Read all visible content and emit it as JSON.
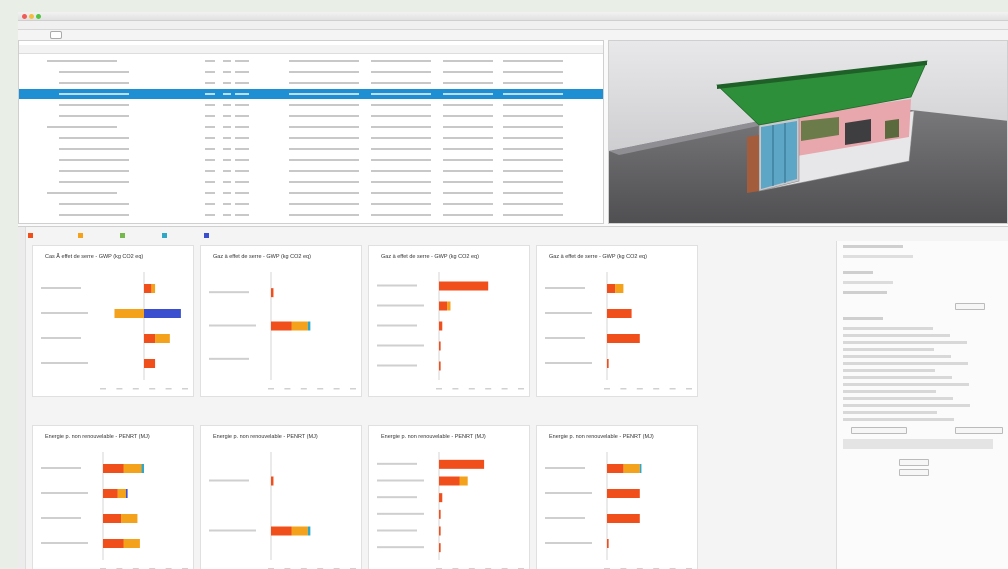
{
  "app": {
    "window_title": "",
    "menu": [
      "",
      "",
      "",
      ""
    ]
  },
  "tree": {
    "columns": [
      "",
      "",
      "",
      "",
      "",
      "",
      "",
      ""
    ],
    "row_count": 15,
    "selected_row": 3
  },
  "analysis": {
    "legend": [
      {
        "label": "",
        "color": "#f04f1c"
      },
      {
        "label": "",
        "color": "#f4a11c"
      },
      {
        "label": "",
        "color": "#76b84c"
      },
      {
        "label": "",
        "color": "#2fa8c8"
      },
      {
        "label": "",
        "color": "#3a4fd0"
      }
    ],
    "panels": [
      {
        "title": "Cas Ã effet de serre - GWP (kg CO2 eq)"
      },
      {
        "title": "Gaz à effet de serre - GWP (kg CO2 eq)"
      },
      {
        "title": "Gaz à effet de serre - GWP (kg CO2 eq)"
      },
      {
        "title": "Gaz à effet de serre - GWP (kg CO2 eq)"
      },
      {
        "title": "Energie p. non renouvelable - PENRT (MJ)"
      },
      {
        "title": "Energie p. non renouvelable - PENRT (MJ)"
      },
      {
        "title": "Energie p. non renouvelable - PENRT (MJ)"
      },
      {
        "title": "Energie p. non renouvelable - PENRT (MJ)"
      }
    ]
  },
  "chart_data": [
    {
      "type": "bar",
      "title": "Cas Ã effet de serre - GWP (kg CO2 eq)",
      "categories": [
        "",
        "",
        "",
        ""
      ],
      "series": [
        {
          "color": "#f04f1c",
          "values": [
            0.2,
            0,
            0.3,
            0.3
          ]
        },
        {
          "color": "#f4a11c",
          "values": [
            0.1,
            -0.8,
            0.4,
            0
          ]
        },
        {
          "color": "#3a4fd0",
          "values": [
            0,
            1.0,
            0,
            0
          ]
        }
      ],
      "diverging": true
    },
    {
      "type": "bar",
      "title": "Gaz à effet de serre - GWP (kg CO2 eq)",
      "categories": [
        "",
        "",
        ""
      ],
      "series": [
        {
          "color": "#f04f1c",
          "values": [
            0.03,
            0.25,
            0
          ]
        },
        {
          "color": "#f4a11c",
          "values": [
            0,
            0.2,
            0
          ]
        },
        {
          "color": "#2fa8c8",
          "values": [
            0,
            0.03,
            0
          ]
        }
      ]
    },
    {
      "type": "bar",
      "title": "Gaz à effet de serre - GWP (kg CO2 eq)",
      "categories": [
        "",
        "",
        "",
        "",
        ""
      ],
      "series": [
        {
          "color": "#f04f1c",
          "values": [
            0.6,
            0.1,
            0.04,
            0.02,
            0.02
          ]
        },
        {
          "color": "#f4a11c",
          "values": [
            0,
            0.04,
            0,
            0,
            0
          ]
        }
      ]
    },
    {
      "type": "bar",
      "title": "Gaz à effet de serre - GWP (kg CO2 eq)",
      "categories": [
        "",
        "",
        "",
        ""
      ],
      "series": [
        {
          "color": "#f04f1c",
          "values": [
            0.1,
            0.3,
            0.4,
            0.02
          ]
        },
        {
          "color": "#f4a11c",
          "values": [
            0.1,
            0,
            0,
            0
          ]
        }
      ]
    },
    {
      "type": "bar",
      "title": "Energie p. non renouvelable - PENRT (MJ)",
      "categories": [
        "",
        "",
        "",
        ""
      ],
      "series": [
        {
          "color": "#f04f1c",
          "values": [
            0.25,
            0.18,
            0.22,
            0.25
          ]
        },
        {
          "color": "#f4a11c",
          "values": [
            0.22,
            0.1,
            0.2,
            0.2
          ]
        },
        {
          "color": "#2fa8c8",
          "values": [
            0.03,
            0,
            0,
            0
          ]
        },
        {
          "color": "#3a4fd0",
          "values": [
            0,
            0.02,
            0,
            0
          ]
        }
      ]
    },
    {
      "type": "bar",
      "title": "Energie p. non renouvelable - PENRT (MJ)",
      "categories": [
        "",
        ""
      ],
      "series": [
        {
          "color": "#f04f1c",
          "values": [
            0.03,
            0.25
          ]
        },
        {
          "color": "#f4a11c",
          "values": [
            0,
            0.2
          ]
        },
        {
          "color": "#2fa8c8",
          "values": [
            0,
            0.03
          ]
        }
      ]
    },
    {
      "type": "bar",
      "title": "Energie p. non renouvelable - PENRT (MJ)",
      "categories": [
        "",
        "",
        "",
        "",
        "",
        ""
      ],
      "series": [
        {
          "color": "#f04f1c",
          "values": [
            0.55,
            0.25,
            0.04,
            0.02,
            0.02,
            0.02
          ]
        },
        {
          "color": "#f4a11c",
          "values": [
            0,
            0.1,
            0,
            0,
            0,
            0
          ]
        }
      ]
    },
    {
      "type": "bar",
      "title": "Energie p. non renouvelable - PENRT (MJ)",
      "categories": [
        "",
        "",
        "",
        ""
      ],
      "series": [
        {
          "color": "#f04f1c",
          "values": [
            0.2,
            0.4,
            0.4,
            0.02
          ]
        },
        {
          "color": "#f4a11c",
          "values": [
            0.2,
            0,
            0,
            0
          ]
        },
        {
          "color": "#2fa8c8",
          "values": [
            0.02,
            0,
            0,
            0
          ]
        }
      ]
    }
  ]
}
